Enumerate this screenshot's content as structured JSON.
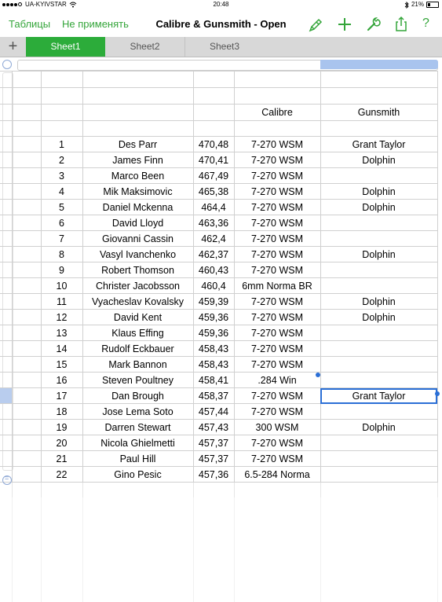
{
  "status_bar": {
    "carrier": "UA-KYIVSTAR",
    "time": "20:48",
    "battery": "21%",
    "battery_level": 0.21
  },
  "toolbar": {
    "back_label": "Таблицы",
    "undo_label": "Не применять",
    "title": "Calibre & Gunsmith - Open",
    "icons": [
      "format-brush-icon",
      "add-icon",
      "wrench-icon",
      "share-icon",
      "help-icon"
    ],
    "help_glyph": "?",
    "accent_color": "#34a53a"
  },
  "tabs": {
    "add_glyph": "+",
    "items": [
      "Sheet1",
      "Sheet2",
      "Sheet3"
    ],
    "active": "Sheet1",
    "active_color": "#2cac3a"
  },
  "table": {
    "headers": [
      "",
      "",
      "",
      "Calibre",
      "Gunsmith"
    ],
    "rows": [
      [
        "1",
        "Des Parr",
        "470,48",
        "7-270 WSM",
        "Grant Taylor"
      ],
      [
        "2",
        "James Finn",
        "470,41",
        "7-270 WSM",
        "Dolphin"
      ],
      [
        "3",
        "Marco Been",
        "467,49",
        "7-270 WSM",
        ""
      ],
      [
        "4",
        "Mik Maksimovic",
        "465,38",
        "7-270 WSM",
        "Dolphin"
      ],
      [
        "5",
        "Daniel Mckenna",
        "464,4",
        "7-270 WSM",
        "Dolphin"
      ],
      [
        "6",
        "David Lloyd",
        "463,36",
        "7-270 WSM",
        ""
      ],
      [
        "7",
        "Giovanni Cassin",
        "462,4",
        "7-270 WSM",
        ""
      ],
      [
        "8",
        "Vasyl Ivanchenko",
        "462,37",
        "7-270 WSM",
        "Dolphin"
      ],
      [
        "9",
        "Robert Thomson",
        "460,43",
        "7-270 WSM",
        ""
      ],
      [
        "10",
        "Christer Jacobsson",
        "460,4",
        "6mm Norma BR",
        ""
      ],
      [
        "11",
        "Vyacheslav Kovalsky",
        "459,39",
        "7-270 WSM",
        "Dolphin"
      ],
      [
        "12",
        "David Kent",
        "459,36",
        "7-270 WSM",
        "Dolphin"
      ],
      [
        "13",
        "Klaus Effing",
        "459,36",
        "7-270 WSM",
        ""
      ],
      [
        "14",
        "Rudolf Eckbauer",
        "458,43",
        "7-270 WSM",
        ""
      ],
      [
        "15",
        "Mark Bannon",
        "458,43",
        "7-270 WSM",
        ""
      ],
      [
        "16",
        "Steven Poultney",
        "458,41",
        ".284 Win",
        ""
      ],
      [
        "17",
        "Dan Brough",
        "458,37",
        "7-270 WSM",
        "Grant Taylor"
      ],
      [
        "18",
        "Jose Lema Soto",
        "457,44",
        "7-270 WSM",
        ""
      ],
      [
        "19",
        "Darren Stewart",
        "457,43",
        "300 WSM",
        "Dolphin"
      ],
      [
        "20",
        "Nicola Ghielmetti",
        "457,37",
        "7-270 WSM",
        ""
      ],
      [
        "21",
        "Paul Hill",
        "457,37",
        "7-270 WSM",
        ""
      ],
      [
        "22",
        "Gino Pesic",
        "457,36",
        "6.5-284 Norma",
        ""
      ]
    ],
    "selected_cell": "Grant Taylor",
    "selection_color": "#2b6fd6"
  }
}
